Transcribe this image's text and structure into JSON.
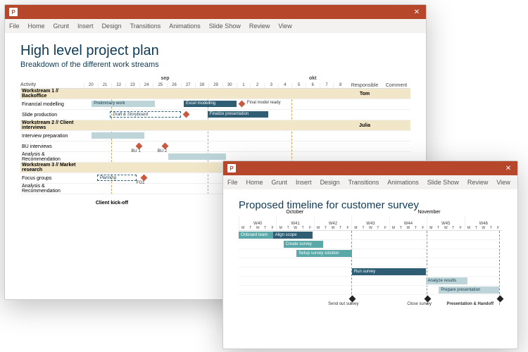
{
  "menu": [
    "File",
    "Home",
    "Grunt",
    "Insert",
    "Design",
    "Transitions",
    "Animations",
    "Slide Show",
    "Review",
    "View"
  ],
  "w1": {
    "title": "High level project plan",
    "subtitle": "Breakdown of the different work streams",
    "activity_label": "Activity",
    "responsible_label": "Responsible",
    "comment_label": "Comment",
    "months": {
      "m1": "sep",
      "m2": "okt"
    },
    "days": [
      "20",
      "21",
      "22",
      "23",
      "24",
      "25",
      "26",
      "27",
      "28",
      "29",
      "30",
      "1",
      "2",
      "3",
      "4",
      "5",
      "6",
      "7",
      "8"
    ],
    "streams": [
      {
        "label": "Workstream 1 // Backoffice",
        "responsible": "Tom"
      },
      {
        "label": "Workstream 2 // Client interviews",
        "responsible": "Julia"
      },
      {
        "label": "Workstream 3 // Market research",
        "responsible": ""
      }
    ],
    "rows": {
      "fm": "Financial modelling",
      "fm_bar1": "Preliminary work",
      "fm_bar2": "Excel modelling",
      "fm_milestone": "Final model ready",
      "sp": "Slide production",
      "sp_bar1": "Draft & Storyboard",
      "sp_bar2": "Finalize presentation",
      "ip": "Interview preparation",
      "bu": "BU interviews",
      "bu_m1": "BU 1",
      "bu_m2": "BU 2",
      "ar": "Analysis & Recommendation",
      "fg": "Focus groups",
      "fg_bar": "Planning",
      "fg_m": "FG1"
    },
    "kickoff": "Client kick-off"
  },
  "w2": {
    "title": "Proposed timeline for customer survey",
    "months": {
      "m1": "October",
      "m2": "November"
    },
    "weeks": [
      "W40",
      "W41",
      "W42",
      "W43",
      "W44",
      "W45",
      "W46"
    ],
    "daylabels": [
      "M",
      "T",
      "W",
      "T",
      "F"
    ],
    "bars": {
      "b1": "Onboard team",
      "b2": "Align scope",
      "b3": "Create survey",
      "b4": "Setup survey solution",
      "b5": "Run survey",
      "b6": "Analyze results",
      "b7": "Prepare presentation"
    },
    "milestones": {
      "m1": "Send out survey",
      "m2": "Close survey",
      "m3": "Presentation & Handoff"
    }
  }
}
